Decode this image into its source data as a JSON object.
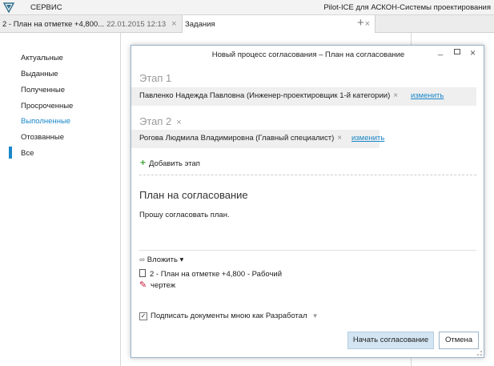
{
  "titlebar": {
    "menu": "СЕРВИС",
    "app_title": "Pilot-ICE для АСКОН-Системы проектирования"
  },
  "tabs": [
    {
      "label": "2 - План на отметке +4,800...",
      "date": "22.01.2015 12:13",
      "close": "×"
    },
    {
      "label": "Задания",
      "close": "×"
    }
  ],
  "tab_add": "+",
  "nav": {
    "items": [
      {
        "label": "Актуальные"
      },
      {
        "label": "Выданные"
      },
      {
        "label": "Полученные"
      },
      {
        "label": "Просроченные"
      },
      {
        "label": "Выполненные",
        "active": true
      },
      {
        "label": "Отозванные"
      },
      {
        "label": "Все"
      }
    ]
  },
  "dialog": {
    "title": "Новый процесс согласования – План на согласование",
    "controls": {
      "minimize": "_",
      "close": "×"
    },
    "stages": [
      {
        "title": "Этап 1",
        "assignee": "Павленко Надежда Павловна (Инженер-проектировщик 1-й категории)",
        "remove": "×",
        "change_link": "изменить"
      },
      {
        "title": "Этап 2",
        "title_remove": "×",
        "assignee": "Рогова Людмила Владимировна (Главный специалист)",
        "remove": "×",
        "change_link": "изменить"
      }
    ],
    "add_stage": "Добавить этап",
    "plan_title": "План на согласование",
    "plan_description": "Прошу согласовать план.",
    "attach_label": "Вложить ▾",
    "document_name_1": "2 - План на отметке +4,800 - Рабочий",
    "document_name_2": "чертеж",
    "sign": {
      "checked": "✓",
      "label": "Подписать документы мною как",
      "role": "Разработал",
      "arrow": "▼"
    },
    "start_button": "Начать согласование",
    "cancel_button": "Отмена"
  },
  "colors": {
    "accent": "#1a87c9",
    "add_icon": "#4aa842",
    "start_button_bg": "#d3e5f2"
  }
}
